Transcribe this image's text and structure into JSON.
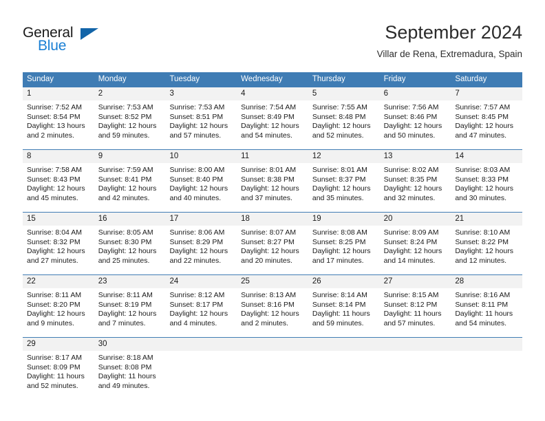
{
  "brand": {
    "name_part1": "General",
    "name_part2": "Blue",
    "triangle_icon": "triangle-icon",
    "accent_blue": "#1a7fd4",
    "triangle_blue": "#1264a8"
  },
  "header": {
    "title": "September 2024",
    "location": "Villar de Rena, Extremadura, Spain"
  },
  "theme": {
    "header_row_bg": "#3f7cb4",
    "daynum_bg": "#f2f2f2",
    "cell_bg": "#ffffff",
    "text": "#1a1a1a"
  },
  "weekdays": [
    "Sunday",
    "Monday",
    "Tuesday",
    "Wednesday",
    "Thursday",
    "Friday",
    "Saturday"
  ],
  "weeks": [
    {
      "days": [
        {
          "num": "1",
          "sunrise": "Sunrise: 7:52 AM",
          "sunset": "Sunset: 8:54 PM",
          "daylight1": "Daylight: 13 hours",
          "daylight2": "and 2 minutes."
        },
        {
          "num": "2",
          "sunrise": "Sunrise: 7:53 AM",
          "sunset": "Sunset: 8:52 PM",
          "daylight1": "Daylight: 12 hours",
          "daylight2": "and 59 minutes."
        },
        {
          "num": "3",
          "sunrise": "Sunrise: 7:53 AM",
          "sunset": "Sunset: 8:51 PM",
          "daylight1": "Daylight: 12 hours",
          "daylight2": "and 57 minutes."
        },
        {
          "num": "4",
          "sunrise": "Sunrise: 7:54 AM",
          "sunset": "Sunset: 8:49 PM",
          "daylight1": "Daylight: 12 hours",
          "daylight2": "and 54 minutes."
        },
        {
          "num": "5",
          "sunrise": "Sunrise: 7:55 AM",
          "sunset": "Sunset: 8:48 PM",
          "daylight1": "Daylight: 12 hours",
          "daylight2": "and 52 minutes."
        },
        {
          "num": "6",
          "sunrise": "Sunrise: 7:56 AM",
          "sunset": "Sunset: 8:46 PM",
          "daylight1": "Daylight: 12 hours",
          "daylight2": "and 50 minutes."
        },
        {
          "num": "7",
          "sunrise": "Sunrise: 7:57 AM",
          "sunset": "Sunset: 8:45 PM",
          "daylight1": "Daylight: 12 hours",
          "daylight2": "and 47 minutes."
        }
      ]
    },
    {
      "days": [
        {
          "num": "8",
          "sunrise": "Sunrise: 7:58 AM",
          "sunset": "Sunset: 8:43 PM",
          "daylight1": "Daylight: 12 hours",
          "daylight2": "and 45 minutes."
        },
        {
          "num": "9",
          "sunrise": "Sunrise: 7:59 AM",
          "sunset": "Sunset: 8:41 PM",
          "daylight1": "Daylight: 12 hours",
          "daylight2": "and 42 minutes."
        },
        {
          "num": "10",
          "sunrise": "Sunrise: 8:00 AM",
          "sunset": "Sunset: 8:40 PM",
          "daylight1": "Daylight: 12 hours",
          "daylight2": "and 40 minutes."
        },
        {
          "num": "11",
          "sunrise": "Sunrise: 8:01 AM",
          "sunset": "Sunset: 8:38 PM",
          "daylight1": "Daylight: 12 hours",
          "daylight2": "and 37 minutes."
        },
        {
          "num": "12",
          "sunrise": "Sunrise: 8:01 AM",
          "sunset": "Sunset: 8:37 PM",
          "daylight1": "Daylight: 12 hours",
          "daylight2": "and 35 minutes."
        },
        {
          "num": "13",
          "sunrise": "Sunrise: 8:02 AM",
          "sunset": "Sunset: 8:35 PM",
          "daylight1": "Daylight: 12 hours",
          "daylight2": "and 32 minutes."
        },
        {
          "num": "14",
          "sunrise": "Sunrise: 8:03 AM",
          "sunset": "Sunset: 8:33 PM",
          "daylight1": "Daylight: 12 hours",
          "daylight2": "and 30 minutes."
        }
      ]
    },
    {
      "days": [
        {
          "num": "15",
          "sunrise": "Sunrise: 8:04 AM",
          "sunset": "Sunset: 8:32 PM",
          "daylight1": "Daylight: 12 hours",
          "daylight2": "and 27 minutes."
        },
        {
          "num": "16",
          "sunrise": "Sunrise: 8:05 AM",
          "sunset": "Sunset: 8:30 PM",
          "daylight1": "Daylight: 12 hours",
          "daylight2": "and 25 minutes."
        },
        {
          "num": "17",
          "sunrise": "Sunrise: 8:06 AM",
          "sunset": "Sunset: 8:29 PM",
          "daylight1": "Daylight: 12 hours",
          "daylight2": "and 22 minutes."
        },
        {
          "num": "18",
          "sunrise": "Sunrise: 8:07 AM",
          "sunset": "Sunset: 8:27 PM",
          "daylight1": "Daylight: 12 hours",
          "daylight2": "and 20 minutes."
        },
        {
          "num": "19",
          "sunrise": "Sunrise: 8:08 AM",
          "sunset": "Sunset: 8:25 PM",
          "daylight1": "Daylight: 12 hours",
          "daylight2": "and 17 minutes."
        },
        {
          "num": "20",
          "sunrise": "Sunrise: 8:09 AM",
          "sunset": "Sunset: 8:24 PM",
          "daylight1": "Daylight: 12 hours",
          "daylight2": "and 14 minutes."
        },
        {
          "num": "21",
          "sunrise": "Sunrise: 8:10 AM",
          "sunset": "Sunset: 8:22 PM",
          "daylight1": "Daylight: 12 hours",
          "daylight2": "and 12 minutes."
        }
      ]
    },
    {
      "days": [
        {
          "num": "22",
          "sunrise": "Sunrise: 8:11 AM",
          "sunset": "Sunset: 8:20 PM",
          "daylight1": "Daylight: 12 hours",
          "daylight2": "and 9 minutes."
        },
        {
          "num": "23",
          "sunrise": "Sunrise: 8:11 AM",
          "sunset": "Sunset: 8:19 PM",
          "daylight1": "Daylight: 12 hours",
          "daylight2": "and 7 minutes."
        },
        {
          "num": "24",
          "sunrise": "Sunrise: 8:12 AM",
          "sunset": "Sunset: 8:17 PM",
          "daylight1": "Daylight: 12 hours",
          "daylight2": "and 4 minutes."
        },
        {
          "num": "25",
          "sunrise": "Sunrise: 8:13 AM",
          "sunset": "Sunset: 8:16 PM",
          "daylight1": "Daylight: 12 hours",
          "daylight2": "and 2 minutes."
        },
        {
          "num": "26",
          "sunrise": "Sunrise: 8:14 AM",
          "sunset": "Sunset: 8:14 PM",
          "daylight1": "Daylight: 11 hours",
          "daylight2": "and 59 minutes."
        },
        {
          "num": "27",
          "sunrise": "Sunrise: 8:15 AM",
          "sunset": "Sunset: 8:12 PM",
          "daylight1": "Daylight: 11 hours",
          "daylight2": "and 57 minutes."
        },
        {
          "num": "28",
          "sunrise": "Sunrise: 8:16 AM",
          "sunset": "Sunset: 8:11 PM",
          "daylight1": "Daylight: 11 hours",
          "daylight2": "and 54 minutes."
        }
      ]
    },
    {
      "days": [
        {
          "num": "29",
          "sunrise": "Sunrise: 8:17 AM",
          "sunset": "Sunset: 8:09 PM",
          "daylight1": "Daylight: 11 hours",
          "daylight2": "and 52 minutes."
        },
        {
          "num": "30",
          "sunrise": "Sunrise: 8:18 AM",
          "sunset": "Sunset: 8:08 PM",
          "daylight1": "Daylight: 11 hours",
          "daylight2": "and 49 minutes."
        },
        {
          "num": "",
          "sunrise": "",
          "sunset": "",
          "daylight1": "",
          "daylight2": ""
        },
        {
          "num": "",
          "sunrise": "",
          "sunset": "",
          "daylight1": "",
          "daylight2": ""
        },
        {
          "num": "",
          "sunrise": "",
          "sunset": "",
          "daylight1": "",
          "daylight2": ""
        },
        {
          "num": "",
          "sunrise": "",
          "sunset": "",
          "daylight1": "",
          "daylight2": ""
        },
        {
          "num": "",
          "sunrise": "",
          "sunset": "",
          "daylight1": "",
          "daylight2": ""
        }
      ]
    }
  ]
}
